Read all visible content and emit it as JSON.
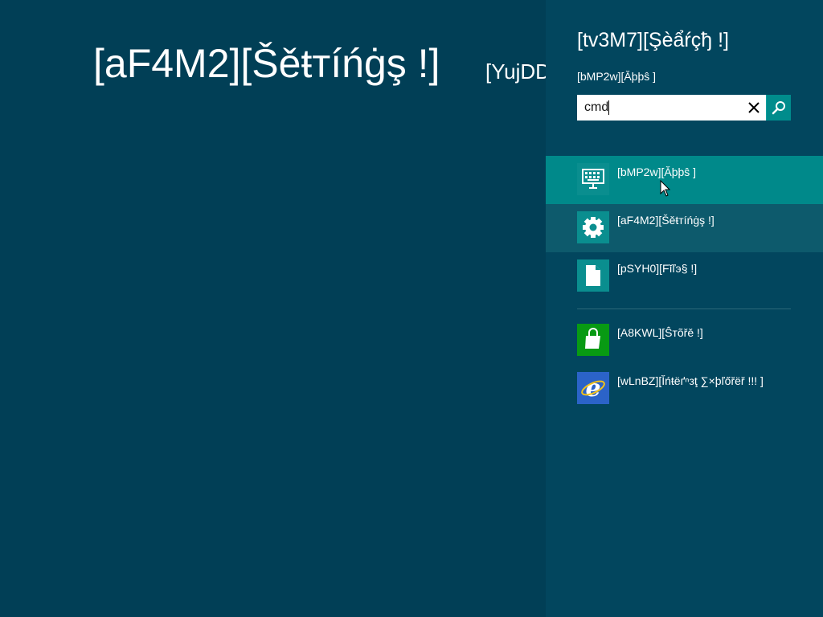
{
  "main": {
    "title": "[aF4M2][Šěŧтíńġş !]",
    "subtitle": "[YujDD"
  },
  "search_pane": {
    "title": "[tv3M7][Şèẩŕçђ !]",
    "scope": "[bMP2w][Ăþþŝ ]",
    "search_value": "cmd",
    "clear_icon": "close-icon",
    "search_icon": "magnifier-icon",
    "results": [
      {
        "label": "[bMP2w][Ăþþŝ ]",
        "icon": "apps-keyboard-icon"
      },
      {
        "label": "[aF4M2][Šěŧтíńġş !]",
        "icon": "gear-icon"
      },
      {
        "label": "[pSYH0][Fĭľэ§ !]",
        "icon": "file-icon"
      }
    ],
    "apps": [
      {
        "label": "[A8KWL][Ŝтõřě !]",
        "icon": "store-bag-icon"
      },
      {
        "label": "[wLnBZ][Ĭńŧëґⁿзţ ∑×þľőřëř !!! ]",
        "icon": "internet-explorer-icon"
      }
    ]
  },
  "colors": {
    "background": "#013f56",
    "pane": "#02465e",
    "selected": "#00898a",
    "hover": "#0d5a6c",
    "accent": "#008c8c",
    "store_green": "#089a13",
    "ie_blue": "#2b63c8"
  }
}
